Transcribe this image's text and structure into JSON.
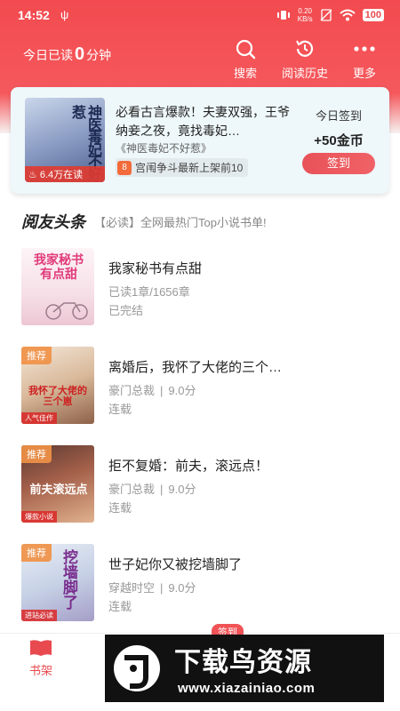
{
  "status_bar": {
    "time": "14:52",
    "net_speed_value": "0.20",
    "net_speed_unit": "KB/s",
    "battery": "100"
  },
  "header": {
    "read_prefix": "今日已读",
    "read_minutes": "0",
    "read_suffix": "分钟",
    "actions": [
      {
        "label": "搜索",
        "icon": "search-icon"
      },
      {
        "label": "阅读历史",
        "icon": "history-icon"
      },
      {
        "label": "更多",
        "icon": "more-icon"
      }
    ]
  },
  "sign_card": {
    "cover_title": "神医毒妃不好惹",
    "readers": "6.4万在读",
    "description": "必看古言爆款！夫妻双强，王爷纳妾之夜，竟找毒妃…",
    "book_name": "《神医毒妃不好惹》",
    "tag_icon": "8",
    "tag": "宫闱争斗最新上架前10",
    "sign_today": "今日签到",
    "reward": "+50金币",
    "sign_button": "签到"
  },
  "headline": {
    "logo": "阅友头条",
    "text": "【必读】全网最热门Top小说书单!"
  },
  "books": [
    {
      "title": "我家秘书有点甜",
      "cover_title": "我家秘书有点甜",
      "meta": [
        "已读1章/1656章"
      ],
      "status": "已完结",
      "badge": "",
      "cover_tag": ""
    },
    {
      "title": "离婚后，我怀了大佬的三个…",
      "cover_title": "我怀了大佬的三个崽",
      "meta": [
        "豪门总裁",
        "9.0分"
      ],
      "status": "连载",
      "badge": "推荐",
      "cover_tag": "人气佳作"
    },
    {
      "title": "拒不复婚：前夫，滚远点！",
      "cover_title": "前夫滚远点",
      "meta": [
        "豪门总裁",
        "9.0分"
      ],
      "status": "连载",
      "badge": "推荐",
      "cover_tag": "爆款小说"
    },
    {
      "title": "世子妃你又被挖墙脚了",
      "cover_title": "挖墙脚了",
      "meta": [
        "穿越时空",
        "9.0分"
      ],
      "status": "连载",
      "badge": "推荐",
      "cover_tag": "进站必读"
    }
  ],
  "tabbar": {
    "bookshelf": "书架",
    "sign_pill": "签到"
  },
  "watermark": {
    "title": "下载鸟资源",
    "url": "www.xiazainiao.com"
  },
  "colors": {
    "brand_red": "#f24a4f",
    "card_bg": "#eef7f9",
    "recommend_orange": "#f09146"
  }
}
